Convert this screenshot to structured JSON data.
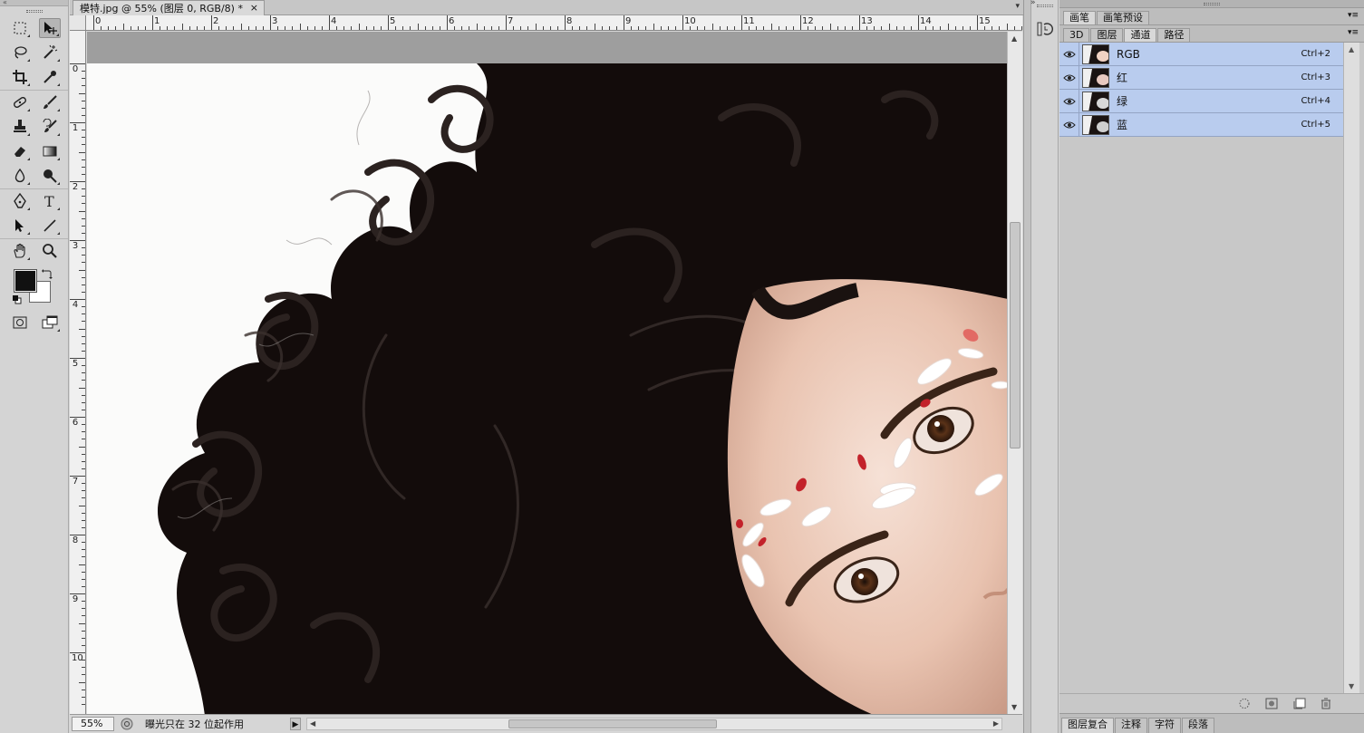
{
  "document": {
    "tab_title": "模特.jpg @ 55% (图层 0, RGB/8) *",
    "close_glyph": "×",
    "tabbar_menu": "▾"
  },
  "rulers": {
    "horizontal": [
      "0",
      "1",
      "2",
      "3",
      "4",
      "5",
      "6",
      "7",
      "8",
      "9",
      "10",
      "11",
      "12",
      "13",
      "14",
      "15"
    ],
    "vertical": [
      "0",
      "1",
      "2",
      "3",
      "4",
      "5",
      "6",
      "7",
      "8",
      "9",
      "10"
    ]
  },
  "toolbar": {
    "collapse": "«",
    "tools": [
      [
        "rect-marquee-icon",
        "move-icon"
      ],
      [
        "lasso-icon",
        "magic-wand-icon"
      ],
      [
        "crop-icon",
        "eyedropper-icon"
      ],
      [
        "healing-brush-icon",
        "brush-icon"
      ],
      [
        "clone-stamp-icon",
        "history-brush-icon"
      ],
      [
        "eraser-icon",
        "gradient-icon"
      ],
      [
        "blur-icon",
        "dodge-icon"
      ],
      [
        "pen-icon",
        "type-icon"
      ],
      [
        "path-select-icon",
        "line-icon"
      ],
      [
        "hand-icon",
        "zoom-icon"
      ]
    ],
    "active_tool": "move-icon",
    "foreground_color": "#111111",
    "background_color": "#ffffff"
  },
  "status": {
    "zoom": "55%",
    "message": "曝光只在 32 位起作用",
    "arrow": "▶"
  },
  "panels": {
    "collapse": "»",
    "top_tabs": [
      {
        "label": "画笔",
        "active": true
      },
      {
        "label": "画笔预设",
        "active": false
      }
    ],
    "main_tabs": [
      {
        "label": "3D",
        "active": false
      },
      {
        "label": "图层",
        "active": false
      },
      {
        "label": "通道",
        "active": true
      },
      {
        "label": "路径",
        "active": false
      }
    ],
    "menu_glyph": "▾≡",
    "channels": [
      {
        "name": "RGB",
        "shortcut": "Ctrl+2"
      },
      {
        "name": "红",
        "shortcut": "Ctrl+3"
      },
      {
        "name": "绿",
        "shortcut": "Ctrl+4"
      },
      {
        "name": "蓝",
        "shortcut": "Ctrl+5"
      }
    ],
    "bottom_tabs": [
      {
        "label": "图层复合",
        "active": true
      },
      {
        "label": "注释",
        "active": false
      },
      {
        "label": "字符",
        "active": false
      },
      {
        "label": "段落",
        "active": false
      }
    ]
  },
  "colors": {
    "selection_row": "#b9ccee",
    "canvas_backdrop": "#9e9e9e"
  }
}
